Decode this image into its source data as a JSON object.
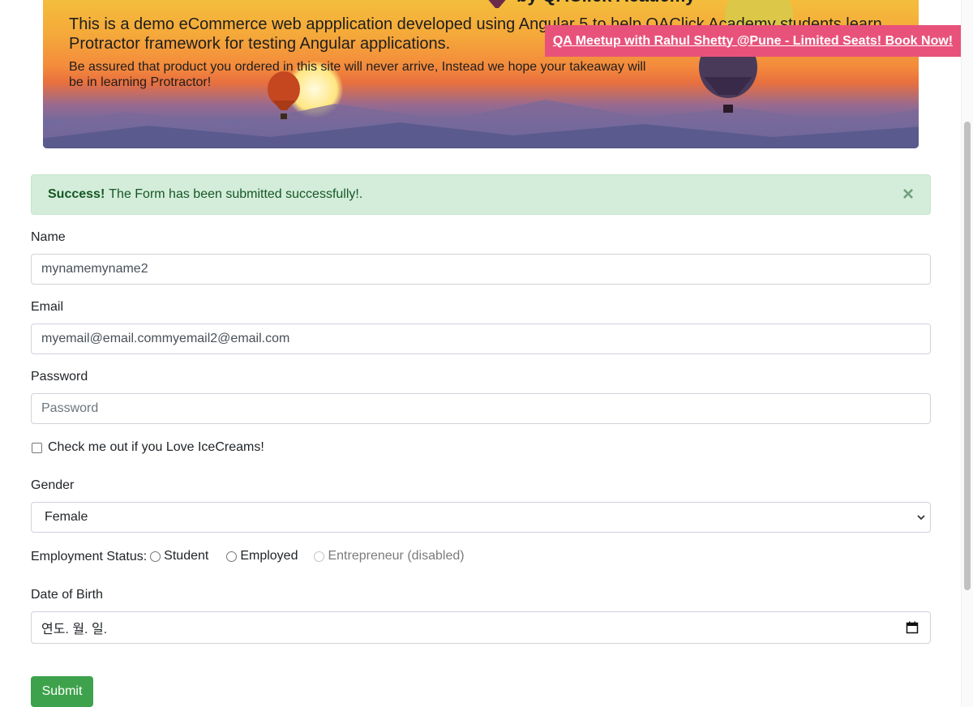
{
  "hero": {
    "title": "by QAClick Academy",
    "line1": "This is a demo eCommerce web appplication developed using Angular 5 to help QAClick Academy students learn Protractor framework for testing Angular applications.",
    "line2": "Be assured that product you ordered in this site will never arrive, Instead we hope your takeaway will be in learning Protractor!"
  },
  "promo": {
    "text": "QA Meetup with Rahul Shetty @Pune - Limited Seats! Book Now!"
  },
  "alert": {
    "strong": "Success!",
    "message": "The Form has been submitted successfully!.",
    "close_glyph": "×"
  },
  "form": {
    "name_label": "Name",
    "name_value": "mynamemyname2",
    "email_label": "Email",
    "email_value": "myemail@email.commyemail2@email.com",
    "password_label": "Password",
    "password_placeholder": "Password",
    "checkbox_label": "Check me out if you Love IceCreams!",
    "gender_label": "Gender",
    "gender_value": "Female",
    "employment_label": "Employment Status:",
    "employment_options": [
      "Student",
      "Employed",
      "Entrepreneur (disabled)"
    ],
    "dob_label": "Date of Birth",
    "dob_placeholder": "연도. 월. 일.",
    "submit_label": "Submit"
  }
}
